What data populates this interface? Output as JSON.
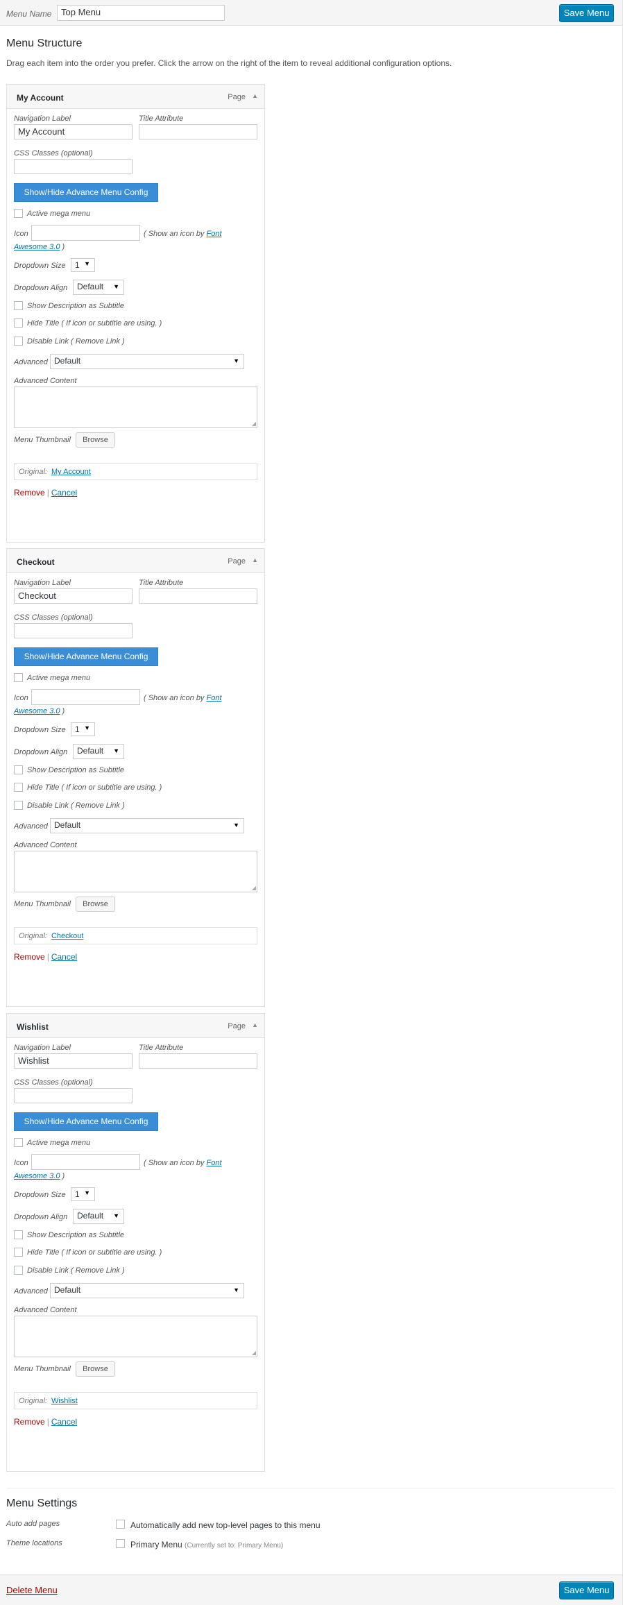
{
  "header": {
    "menu_name_label": "Menu Name",
    "menu_name_value": "Top Menu",
    "save_label": "Save Menu"
  },
  "structure": {
    "title": "Menu Structure",
    "instructions": "Drag each item into the order you prefer. Click the arrow on the right of the item to reveal additional configuration options."
  },
  "common": {
    "type": "Page",
    "nav_label": "Navigation Label",
    "title_attr": "Title Attribute",
    "css_classes": "CSS Classes (optional)",
    "toggle_config": "Show/Hide Advance Menu Config",
    "active_mega": "Active mega menu",
    "icon_label": "Icon",
    "icon_hint_pre": "( Show an icon by ",
    "icon_hint_link_1": "Font",
    "icon_hint_link_2": "Awesome 3.0",
    "icon_hint_post": " )",
    "dropdown_size_label": "Dropdown Size",
    "dropdown_size_value": "1",
    "dropdown_align_label": "Dropdown Align",
    "dropdown_align_value": "Default",
    "show_desc": "Show Description as Subtitle",
    "hide_title": "Hide Title ( If icon or subtitle are using. )",
    "disable_link": "Disable Link ( Remove Link )",
    "advanced_label": "Advanced",
    "advanced_value": "Default",
    "advanced_content": "Advanced Content",
    "thumbnail_label": "Menu Thumbnail",
    "browse": "Browse",
    "original_label": "Original:",
    "remove": "Remove",
    "separator": "|",
    "cancel": "Cancel",
    "caret": "▼",
    "arrow_up": "▲",
    "grip": "◢"
  },
  "items": [
    {
      "title": "My Account",
      "nav_value": "My Account",
      "original_link": "My Account"
    },
    {
      "title": "Checkout",
      "nav_value": "Checkout",
      "original_link": "Checkout"
    },
    {
      "title": "Wishlist",
      "nav_value": "Wishlist",
      "original_link": "Wishlist"
    }
  ],
  "settings": {
    "title": "Menu Settings",
    "auto_add_label": "Auto add pages",
    "auto_add_text": "Automatically add new top-level pages to this menu",
    "theme_locations_label": "Theme locations",
    "primary_menu": "Primary Menu",
    "primary_menu_note": "(Currently set to: Primary Menu)"
  },
  "footer": {
    "delete_label": "Delete Menu",
    "save_label": "Save Menu"
  }
}
